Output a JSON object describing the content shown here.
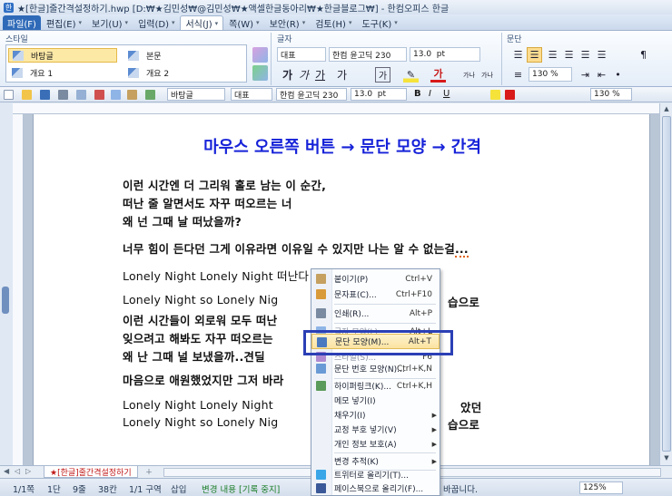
{
  "window": {
    "title": "★[한글]줄간격설정하기.hwp [D:₩★김민성₩@김민성₩★액셀한글동아리₩★한글블로그₩] - 한컴오피스 한글"
  },
  "menu": {
    "items": [
      {
        "label": "파일(F)"
      },
      {
        "label": "편집(E)"
      },
      {
        "label": "보기(U)"
      },
      {
        "label": "입력(D)"
      },
      {
        "label": "서식(J)"
      },
      {
        "label": "쪽(W)"
      },
      {
        "label": "보안(R)"
      },
      {
        "label": "검토(H)"
      },
      {
        "label": "도구(K)"
      }
    ]
  },
  "ribbon": {
    "style_group": "스타일",
    "styles": [
      "바탕글",
      "본문",
      "개요 1",
      "개요 2"
    ],
    "font_group": "글자",
    "lang": "대표",
    "font": "한컴 윤고딕 230",
    "size": "13.0",
    "unit": "pt",
    "para_group": "문단",
    "line_spacing": "130",
    "percent": "%",
    "bold": "가",
    "italic": "가",
    "underline": "가",
    "strike": "가",
    "shade": "가",
    "char_border": "가",
    "color_text": "가",
    "super": "가나",
    "sub": "가나"
  },
  "toolbar": {
    "style": "바탕글",
    "lang": "대표",
    "font": "한컴 윤고딕 230",
    "size": "13.0",
    "unit": "pt",
    "spacing": "130",
    "percent": "%"
  },
  "document": {
    "title": "마우스 오른쪽 버튼 → 문단 모양 → 간격",
    "lines": [
      "이런 시간엔 더 그리워 홀로 남는 이 순간,",
      "떠난 줄 알면서도 자꾸 떠오르는 너",
      "왜 넌 그때 날 떠났을까?",
      "너무 힘이 든다던 그게 이유라면 이유일 수 있지만 나는 알 수 없는걸",
      "...",
      "Lonely Night Lonely Night 떠난다 그 목소리 남았던",
      "Lonely Night so Lonely Nig",
      "습으로",
      "이런 시간들이 외로워 모두 떠난",
      "잊으려고 해봐도 자꾸 떠오르는",
      "왜 난 그때 널 보냈을까..견딜",
      "마음으로 애원했었지만 그저 바라",
      "Lonely Night Lonely Night",
      "았던",
      "Lonely Night so Lonely Nig",
      "습으로"
    ]
  },
  "context_menu": {
    "items": [
      {
        "label": "붙이기(P)",
        "shortcut": "Ctrl+V"
      },
      {
        "label": "문자표(C)...",
        "shortcut": "Ctrl+F10"
      },
      {
        "label": "인쇄(R)...",
        "shortcut": "Alt+P"
      },
      {
        "label": "글자 모양(L)...",
        "shortcut": "Alt+L"
      },
      {
        "label": "문단 모양(M)...",
        "shortcut": "Alt+T"
      },
      {
        "label": "스타일(S)...",
        "shortcut": "F6"
      },
      {
        "label": "문단 번호 모양(N)...",
        "shortcut": "Ctrl+K,N"
      },
      {
        "label": "하이퍼링크(K)...",
        "shortcut": "Ctrl+K,H"
      },
      {
        "label": "메모 넣기(I)",
        "shortcut": ""
      },
      {
        "label": "채우기(I)",
        "shortcut": ""
      },
      {
        "label": "교정 부호 넣기(V)",
        "shortcut": ""
      },
      {
        "label": "개인 정보 보호(A)",
        "shortcut": ""
      },
      {
        "label": "변경 추적(K)",
        "shortcut": ""
      },
      {
        "label": "트위터로 올리기(T)...",
        "shortcut": ""
      },
      {
        "label": "페이스북으로 올리기(F)...",
        "shortcut": ""
      }
    ]
  },
  "tabs": {
    "doc_tab": "★[한글]줄간격설정하기"
  },
  "status": {
    "page": "1/1쪽",
    "section": "1단",
    "line": "9줄",
    "col": "38칸",
    "sect": "1/1 구역",
    "insert": "삽입",
    "track": "변경 내용 [기록 중지]",
    "tail": "바꿉니다.",
    "zoom": "125%"
  }
}
